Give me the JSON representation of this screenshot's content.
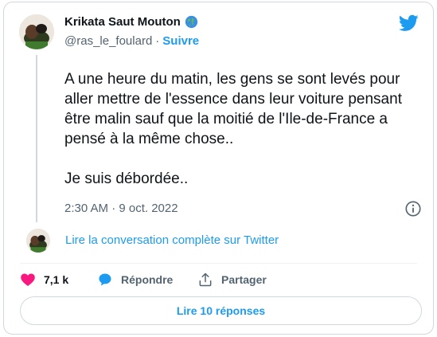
{
  "author": {
    "name": "Krikata Saut Mouton",
    "name_emoji_icon": "globe-icon",
    "handle": "@ras_le_foulard",
    "separator": "·",
    "follow_label": "Suivre"
  },
  "tweet": {
    "paragraph_1": "A une heure du matin, les gens se sont levés pour aller mettre de l'essence dans leur voiture pensant être malin sauf que la moitié de l'Ile-de-France a pensé à la même chose..",
    "paragraph_2": "Je suis débordée..",
    "timestamp": "2:30 AM · 9 oct. 2022"
  },
  "conversation": {
    "read_label": "Lire la conversation complète sur Twitter"
  },
  "actions": {
    "like_count": "7,1 k",
    "reply_label": "Répondre",
    "share_label": "Partager"
  },
  "replies": {
    "button_label": "Lire 10 réponses"
  },
  "colors": {
    "accent": "#1d9bf0",
    "like": "#f91880",
    "secondary_text": "#536471",
    "border": "#cfd9de"
  }
}
